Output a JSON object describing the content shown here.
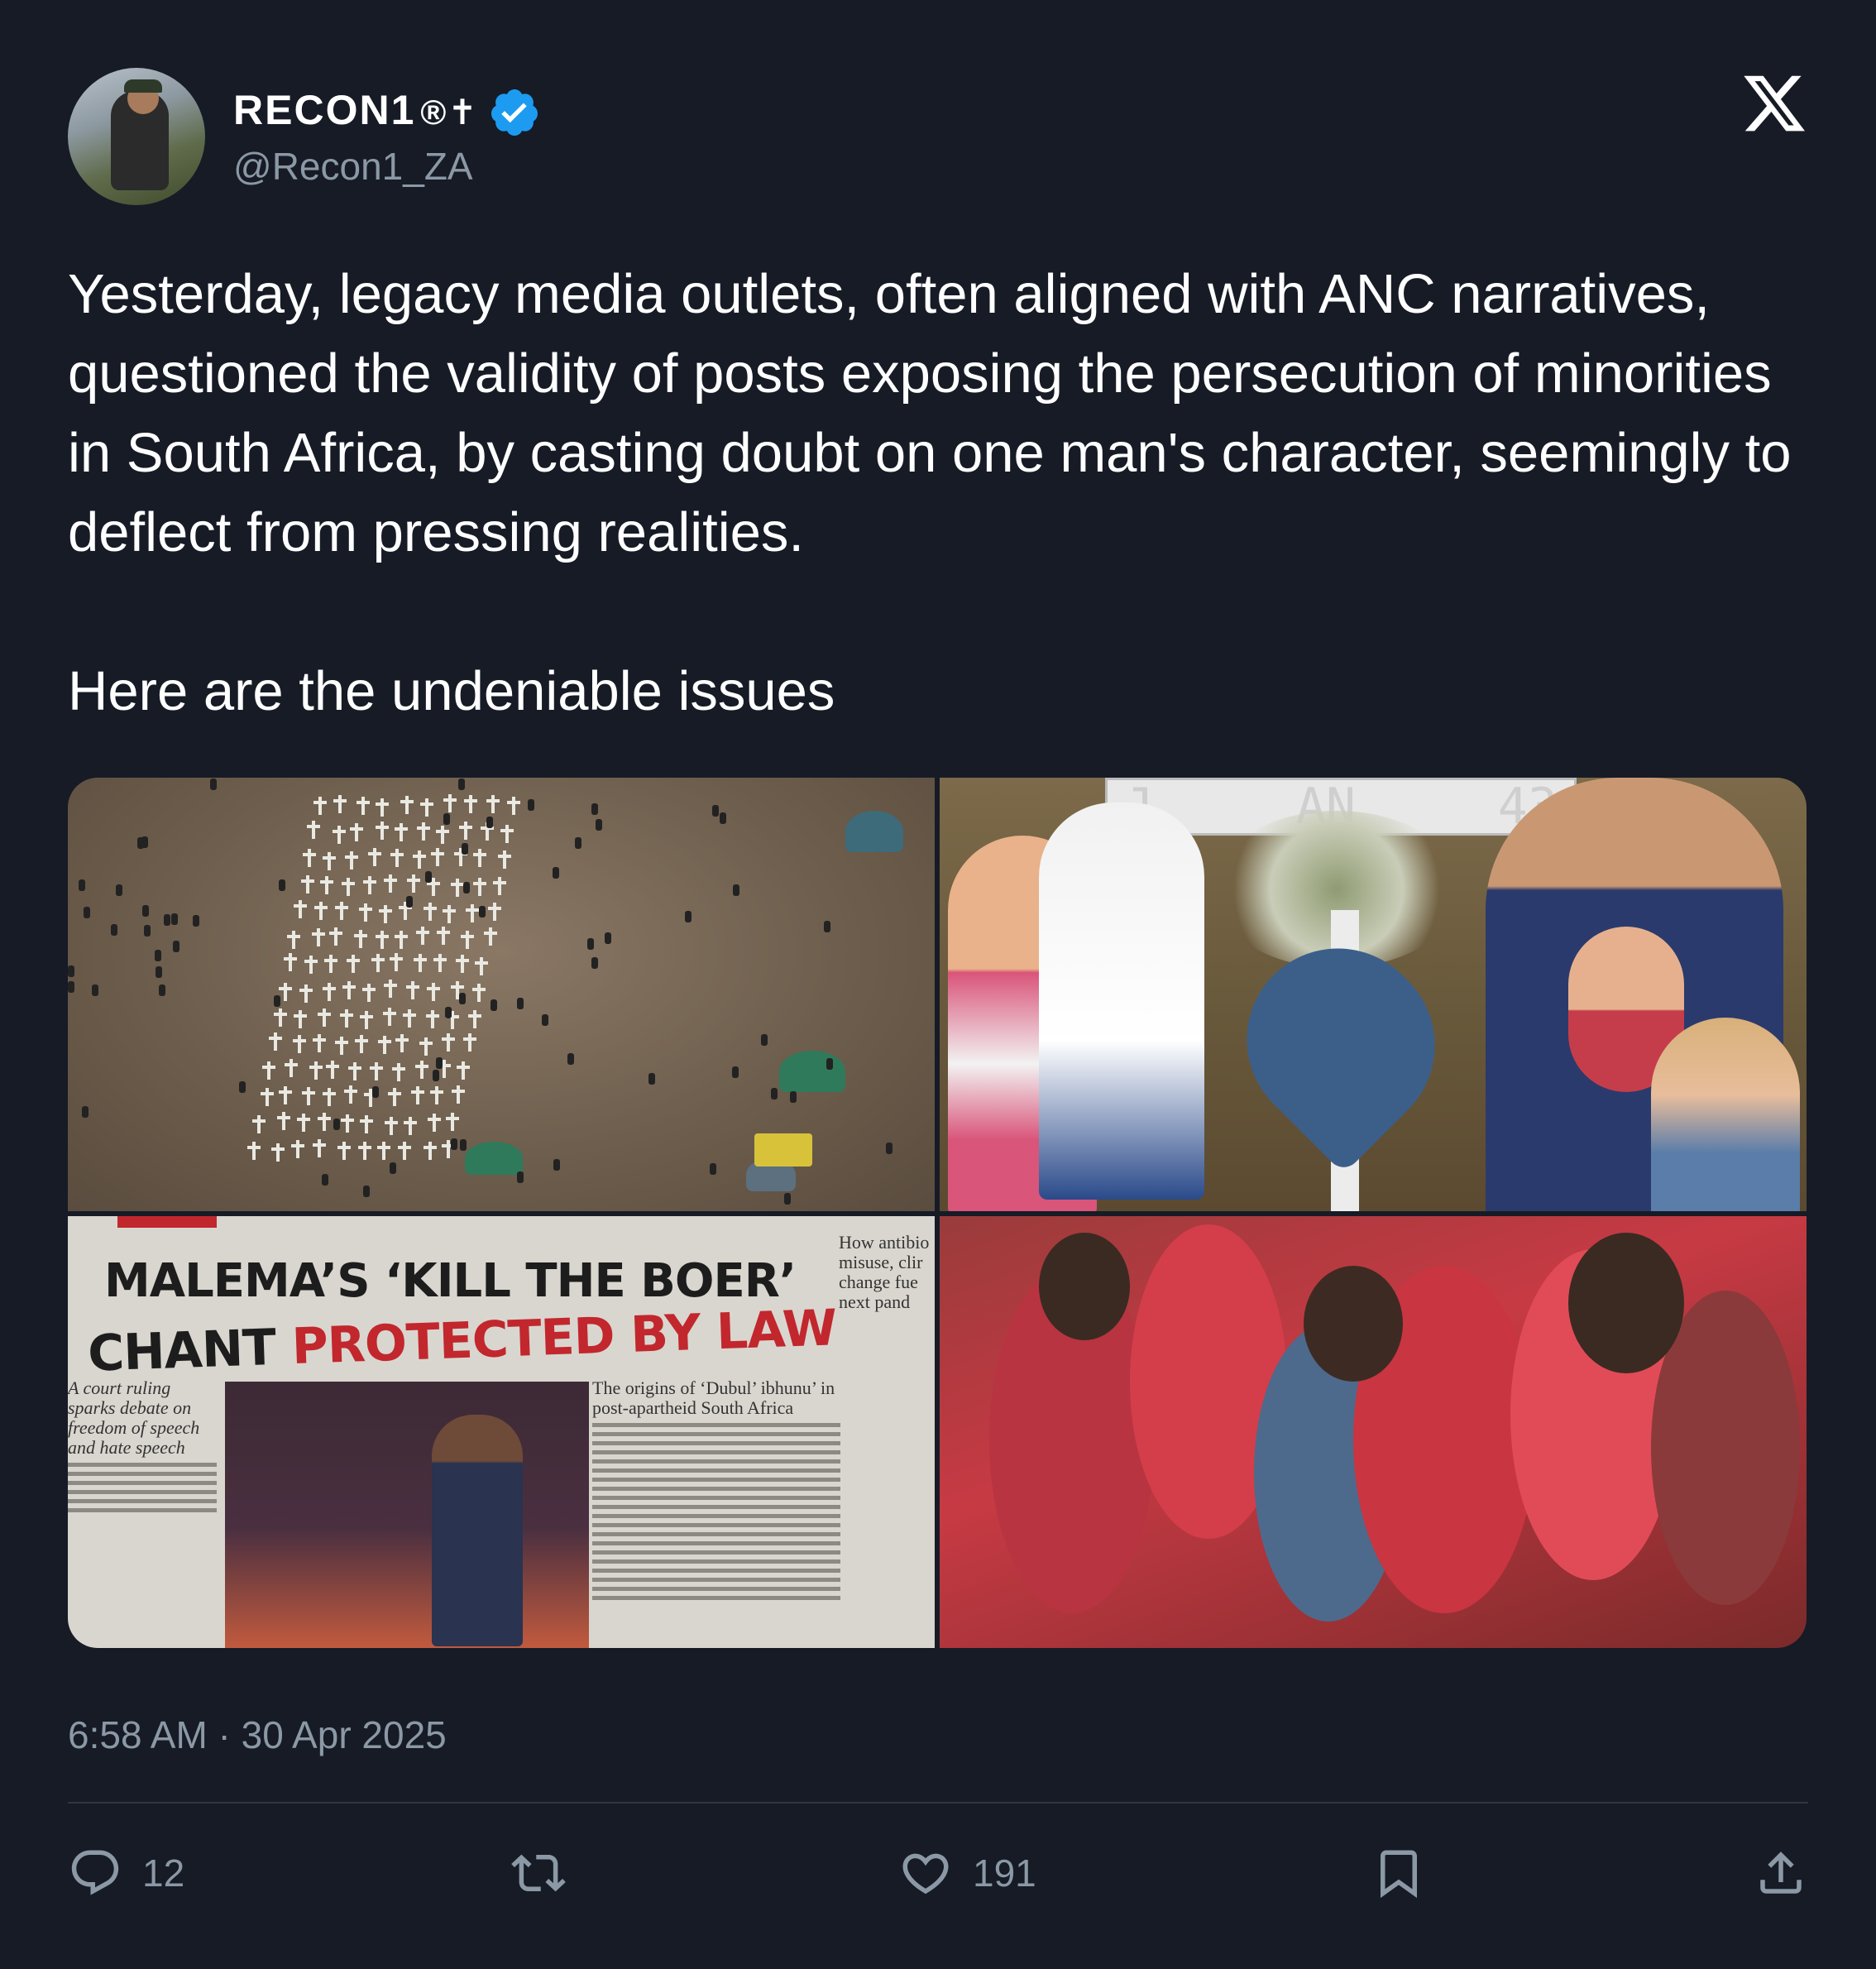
{
  "author": {
    "display_name": "RECON1",
    "name_symbols": "®✝",
    "handle": "@Recon1_ZA",
    "verified": true
  },
  "brand_icon": "x-logo",
  "tweet": {
    "text": "Yesterday, legacy media outlets, often aligned with ANC narratives, questioned the validity of posts exposing the persecution of minorities in South Africa, by casting doubt on one man's character, seemingly to deflect from pressing realities.\n\nHere are the undeniable issues"
  },
  "media": {
    "image_2": {
      "sign_left": "J",
      "sign_mid": "AN",
      "sign_right": "43"
    },
    "image_3": {
      "headline_line1": "MALEMA’S ‘KILL THE BOER’",
      "headline_line2_black": "CHANT ",
      "headline_line2_red": "PROTECTED BY LAW",
      "sidebar": "How antibio misuse, clir change fue next pand",
      "pull_quote": "A court ruling sparks debate on freedom of speech and hate speech",
      "article_title": "The origins of ‘Dubul’ ibhunu’ in post-apartheid South Africa"
    }
  },
  "timestamp": "6:58 AM · 30 Apr 2025",
  "actions": {
    "replies": "12",
    "retweets": "",
    "likes": "191"
  },
  "colors": {
    "background": "#161b26",
    "verified_blue": "#1d9bf0",
    "secondary_text": "#8b98a5"
  }
}
